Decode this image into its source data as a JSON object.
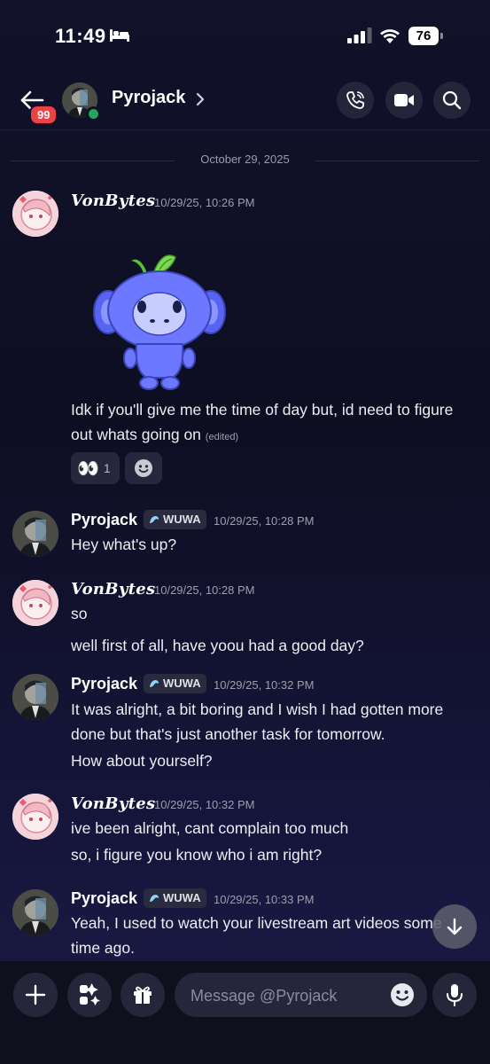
{
  "status_bar": {
    "time": "11:49",
    "battery": "76"
  },
  "header": {
    "unread_badge": "99",
    "username": "Pyrojack"
  },
  "date_divider": "October 29, 2025",
  "messages": [
    {
      "author": "VonBytes",
      "timestamp": "10/29/25, 10:26 PM",
      "lines": [
        "Idk if you'll give me the time of day but, id need to figure out whats going on"
      ],
      "edited_label": "(edited)",
      "reactions": [
        {
          "emoji": "👀",
          "count": "1"
        }
      ]
    },
    {
      "author": "Pyrojack",
      "tag": "WUWA",
      "timestamp": "10/29/25, 10:28 PM",
      "lines": [
        "Hey what's up?"
      ]
    },
    {
      "author": "VonBytes",
      "timestamp": "10/29/25, 10:28 PM",
      "lines": [
        "so",
        "well first of all, have yoou had a good day?"
      ]
    },
    {
      "author": "Pyrojack",
      "tag": "WUWA",
      "timestamp": "10/29/25, 10:32 PM",
      "lines": [
        "It was alright, a bit boring and I wish I had gotten more done but that's just another task for tomorrow.",
        "How about yourself?"
      ]
    },
    {
      "author": "VonBytes",
      "timestamp": "10/29/25, 10:32 PM",
      "lines": [
        "ive been alright, cant complain too much",
        "so, i figure you know who i am right?"
      ]
    },
    {
      "author": "Pyrojack",
      "tag": "WUWA",
      "timestamp": "10/29/25, 10:33 PM",
      "lines": [
        "Yeah, I used to watch your livestream art videos some time ago."
      ]
    }
  ],
  "composer": {
    "placeholder": "Message @Pyrojack"
  },
  "icons": {
    "status": [
      "bed-icon",
      "signal-icon",
      "wifi-icon",
      "battery-icon"
    ],
    "header": [
      "back-arrow-icon",
      "chevron-right-icon",
      "phone-icon",
      "video-icon",
      "search-icon"
    ],
    "composer": [
      "plus-icon",
      "apps-icon",
      "gift-icon",
      "emoji-icon",
      "microphone-icon"
    ],
    "other": [
      "arrow-down-icon",
      "add-reaction-icon",
      "wuwa-icon"
    ]
  },
  "colors": {
    "background": "#11112a",
    "badge": "#ed4245",
    "online": "#23a55a",
    "accent": "#5865f2",
    "input": "#26263a"
  }
}
